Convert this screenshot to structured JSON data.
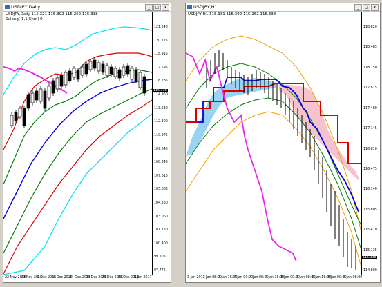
{
  "windows": [
    {
      "title": "USDJPY,Daily",
      "symbol_line": "USDJPY,Daily 115.321 115.392 115.262 115.338",
      "indicator_line": "Sulong(-1,1(Shm) 0",
      "y_labels": [
        "121.540",
        "120.225",
        "118.915",
        "117.595",
        "116.285",
        "114.960",
        "113.630",
        "112.300",
        "110.975",
        "109.645",
        "108.345",
        "107.015",
        "105.685",
        "104.380",
        "103.060",
        "101.730",
        "100.400",
        "99.105",
        "97.775"
      ],
      "x_labels": [
        "22 Nov 2016",
        "29 Nov 2016",
        "1 Dec 2016",
        "8 Dec 2016",
        "14 Dec 2016",
        "20 Dec 2016",
        "26 Dec 2016",
        "30 Dec 2016",
        "5 Jan 2017"
      ],
      "current_price": "115.338"
    },
    {
      "title": "USDJPY,H1",
      "symbol_line": "USDJPY,H1 115.331 115.392 115.262 115.338",
      "y_labels": [
        "118.820",
        "118.485",
        "118.150",
        "117.815",
        "117.480",
        "117.145",
        "116.810",
        "116.475",
        "116.140",
        "115.805",
        "115.470",
        "115.135",
        "114.800"
      ],
      "y_labels_top": [
        "118.820",
        "118.455",
        "118.090",
        "117.725",
        "117.360",
        "116.995",
        "116.630",
        "116.265",
        "115.900",
        "115.535",
        "115.170",
        "114.805"
      ],
      "x_labels": [
        "3 Jan 2017",
        "3 Jan 08:00",
        "3 Jan 16:00",
        "4 Jan 00:00",
        "4 Jan 08:00",
        "4 Jan 16:00",
        "5 Jan 00:00",
        "5 Jan 08:00",
        "5 Jan 16:00",
        "6 Jan 00:00",
        "6 Jan 08:00"
      ],
      "current_price": "115.338"
    }
  ],
  "window_buttons": {
    "minimize": "_",
    "maximize": "□",
    "close": "x"
  },
  "colors": {
    "cyan": "#00e5ee",
    "red": "#dd0000",
    "darkred": "#aa0000",
    "green": "#007a00",
    "blue": "#0000dd",
    "magenta": "#ee22ee",
    "orange": "#f0a000",
    "cloud_blue": "#7ec8f0",
    "cloud_pink": "#f4b8c4"
  }
}
